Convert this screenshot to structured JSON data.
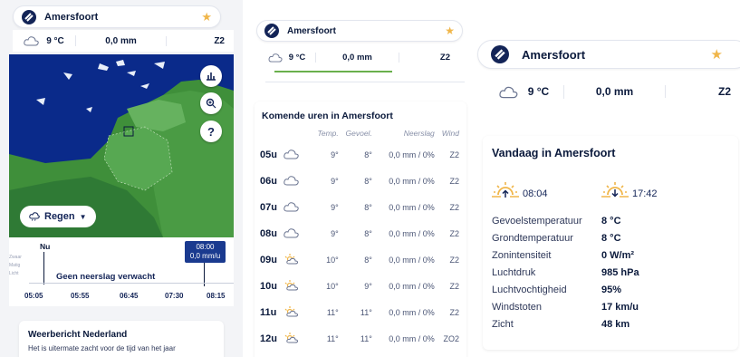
{
  "panel1": {
    "location": {
      "name": "Amersfoort",
      "favorite_icon": "star-icon"
    },
    "current": {
      "temperature": "9 °C",
      "precipitation": "0,0 mm",
      "wind": "Z2",
      "icon": "cloud-icon"
    },
    "map": {
      "layer_label": "Regen",
      "buttons": [
        "chart-icon",
        "zoom-icon",
        "help-icon"
      ],
      "help_glyph": "?"
    },
    "timeline": {
      "now_label": "Nu",
      "selected_time": "08:00",
      "selected_value": "0,0 mm/u",
      "levels": [
        "Zwaar",
        "Matig",
        "Licht"
      ],
      "message": "Geen neerslag verwacht",
      "ticks": [
        "05:05",
        "05:55",
        "06:45",
        "07:30",
        "08:15"
      ]
    },
    "news": {
      "title": "Weerbericht Nederland",
      "text": "Het is uitermate zacht voor de tijd van het jaar"
    }
  },
  "panel2": {
    "location": {
      "name": "Amersfoort"
    },
    "current": {
      "temperature": "9 °C",
      "precipitation": "0,0 mm",
      "wind": "Z2"
    },
    "forecast": {
      "title": "Komende uren in Amersfoort",
      "headers": {
        "temp": "Temp.",
        "feel": "Gevoel.",
        "precip": "Neerslag",
        "wind": "Wind"
      },
      "rows": [
        {
          "hour": "05u",
          "icon": "cloud-icon",
          "temp": "9°",
          "feel": "8°",
          "precip": "0,0 mm / 0%",
          "wind": "Z2"
        },
        {
          "hour": "06u",
          "icon": "cloud-icon",
          "temp": "9°",
          "feel": "8°",
          "precip": "0,0 mm / 0%",
          "wind": "Z2"
        },
        {
          "hour": "07u",
          "icon": "cloud-icon",
          "temp": "9°",
          "feel": "8°",
          "precip": "0,0 mm / 0%",
          "wind": "Z2"
        },
        {
          "hour": "08u",
          "icon": "cloud-icon",
          "temp": "9°",
          "feel": "8°",
          "precip": "0,0 mm / 0%",
          "wind": "Z2"
        },
        {
          "hour": "09u",
          "icon": "sun-cloud-icon",
          "temp": "10°",
          "feel": "8°",
          "precip": "0,0 mm / 0%",
          "wind": "Z2"
        },
        {
          "hour": "10u",
          "icon": "sun-cloud-icon",
          "temp": "10°",
          "feel": "9°",
          "precip": "0,0 mm / 0%",
          "wind": "Z2"
        },
        {
          "hour": "11u",
          "icon": "sun-cloud-icon",
          "temp": "11°",
          "feel": "11°",
          "precip": "0,0 mm / 0%",
          "wind": "Z2"
        },
        {
          "hour": "12u",
          "icon": "sun-cloud-icon",
          "temp": "11°",
          "feel": "11°",
          "precip": "0,0 mm / 0%",
          "wind": "ZO2"
        }
      ]
    }
  },
  "panel3": {
    "location": {
      "name": "Amersfoort"
    },
    "current": {
      "temperature": "9 °C",
      "precipitation": "0,0 mm",
      "wind": "Z2"
    },
    "today": {
      "title": "Vandaag in Amersfoort",
      "sunrise": "08:04",
      "sunset": "17:42",
      "details": [
        {
          "label": "Gevoelstemperatuur",
          "value": "8 °C"
        },
        {
          "label": "Grondtemperatuur",
          "value": "8 °C"
        },
        {
          "label": "Zonintensiteit",
          "value": "0 W/m²"
        },
        {
          "label": "Luchtdruk",
          "value": "985 hPa"
        },
        {
          "label": "Luchtvochtigheid",
          "value": "95%"
        },
        {
          "label": "Windstoten",
          "value": "17 km/u"
        },
        {
          "label": "Zicht",
          "value": "48 km"
        }
      ]
    }
  },
  "colors": {
    "navy": "#132457",
    "accent": "#f0b64a",
    "map_sea": "#0a2a8a",
    "map_land": "#3f8f3a",
    "highlight": "#1a3a8f"
  }
}
